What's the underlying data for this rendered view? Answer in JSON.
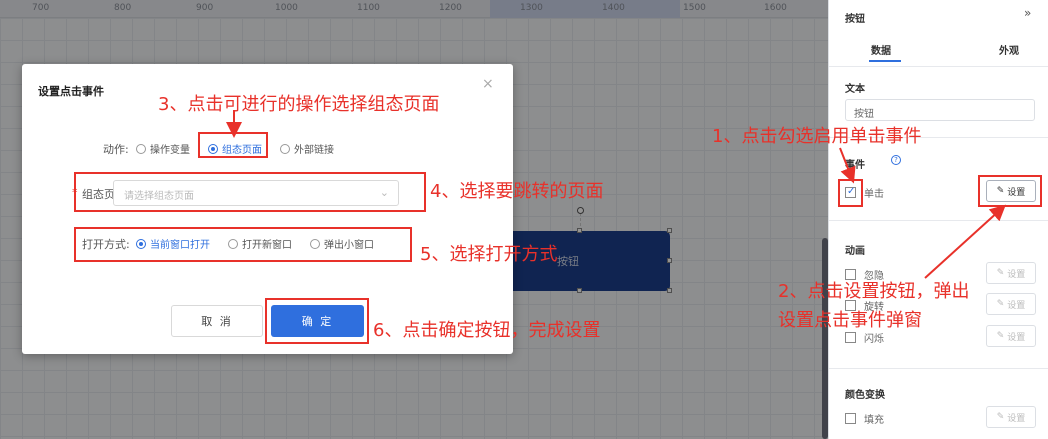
{
  "ruler": {
    "ticks": [
      "700",
      "800",
      "900",
      "1000",
      "1100",
      "1200",
      "1300",
      "1400",
      "1500",
      "1600"
    ]
  },
  "canvas": {
    "widget_label": "按钮"
  },
  "dialog": {
    "title": "设置点击事件",
    "close_glyph": "×",
    "action_label": "动作:",
    "action_options": [
      "操作变量",
      "组态页面",
      "外部链接"
    ],
    "action_selected": "组态页面",
    "page_label": "组态页面:",
    "page_required": "*",
    "page_placeholder": "请选择组态页面",
    "open_label": "打开方式:",
    "open_options": [
      "当前窗口打开",
      "打开新窗口",
      "弹出小窗口"
    ],
    "open_selected": "当前窗口打开",
    "cancel": "取 消",
    "ok": "确 定"
  },
  "annotations": {
    "step1": "1、点击勾选启用单击事件",
    "step2_line1": "2、点击设置按钮，弹出",
    "step2_line2": "设置点击事件弹窗",
    "step3": "3、点击可进行的操作选择组态页面",
    "step4": "4、选择要跳转的页面",
    "step5": "5、选择打开方式",
    "step6": "6、点击确定按钮，完成设置"
  },
  "panel": {
    "title": "按钮",
    "collapse_glyph": "»",
    "tabs": [
      "数据",
      "外观"
    ],
    "text_section": "文本",
    "text_value": "按钮",
    "event_section": "事件",
    "click_label": "单击",
    "click_checked": true,
    "set_label": "设置",
    "anim_section": "动画",
    "anim_items": [
      "忽隐",
      "旋转",
      "闪烁"
    ],
    "color_section": "颜色变换",
    "color_items": [
      "填充"
    ]
  },
  "colors": {
    "accent": "#2f6fde",
    "annotation": "#e8312a",
    "widget": "#1c3f8c"
  }
}
